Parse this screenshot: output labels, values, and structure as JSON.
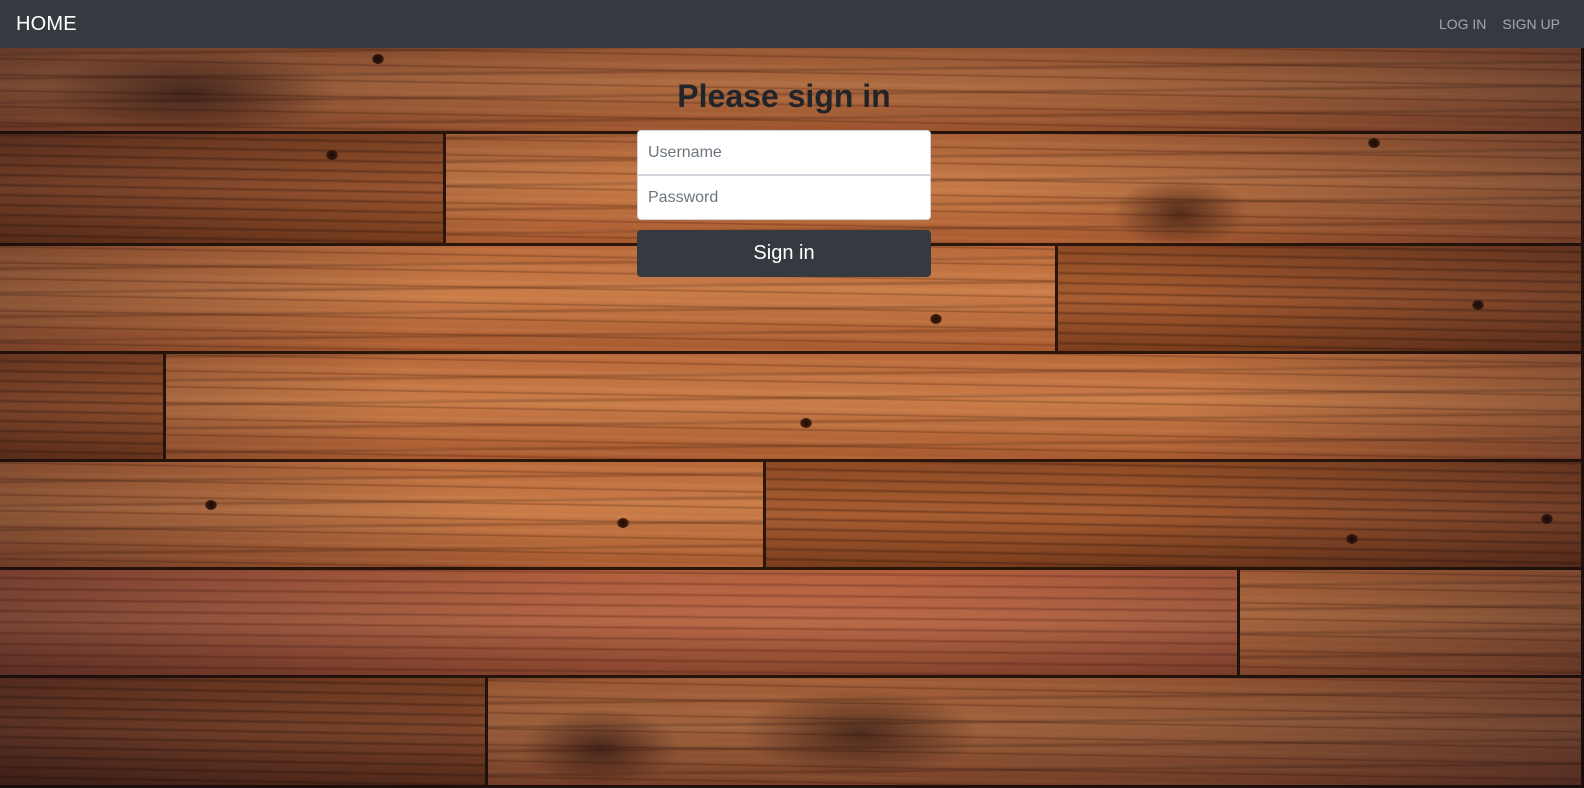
{
  "navbar": {
    "brand": "HOME",
    "links": [
      "LOG IN",
      "SIGN UP"
    ]
  },
  "signin": {
    "heading": "Please sign in",
    "username_placeholder": "Username",
    "username_value": "",
    "password_placeholder": "Password",
    "password_value": "",
    "submit_label": "Sign in"
  },
  "colors": {
    "navbar_bg": "#343a40",
    "button_bg": "#343a40",
    "heading_text": "#212529"
  }
}
